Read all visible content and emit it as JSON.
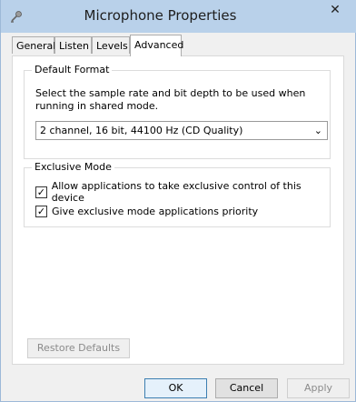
{
  "window": {
    "title": "Microphone Properties",
    "close_glyph": "✕"
  },
  "tabs": [
    {
      "label": "General"
    },
    {
      "label": "Listen"
    },
    {
      "label": "Levels"
    },
    {
      "label": "Advanced"
    }
  ],
  "default_format": {
    "legend": "Default Format",
    "description": "Select the sample rate and bit depth to be used when running in shared mode.",
    "selected": "2 channel, 16 bit, 44100 Hz (CD Quality)",
    "arrow": "⌄"
  },
  "exclusive_mode": {
    "legend": "Exclusive Mode",
    "options": [
      {
        "label": "Allow applications to take exclusive control of this device",
        "checked": true
      },
      {
        "label": "Give exclusive mode applications priority",
        "checked": true
      }
    ]
  },
  "buttons": {
    "restore": "Restore Defaults",
    "ok": "OK",
    "cancel": "Cancel",
    "apply": "Apply"
  },
  "icons": {
    "window": "microphone-icon",
    "check": "✓"
  },
  "colors": {
    "titlebar": "#b9d1ea",
    "panel": "#ffffff",
    "default_button_border": "#3c7fb1"
  }
}
